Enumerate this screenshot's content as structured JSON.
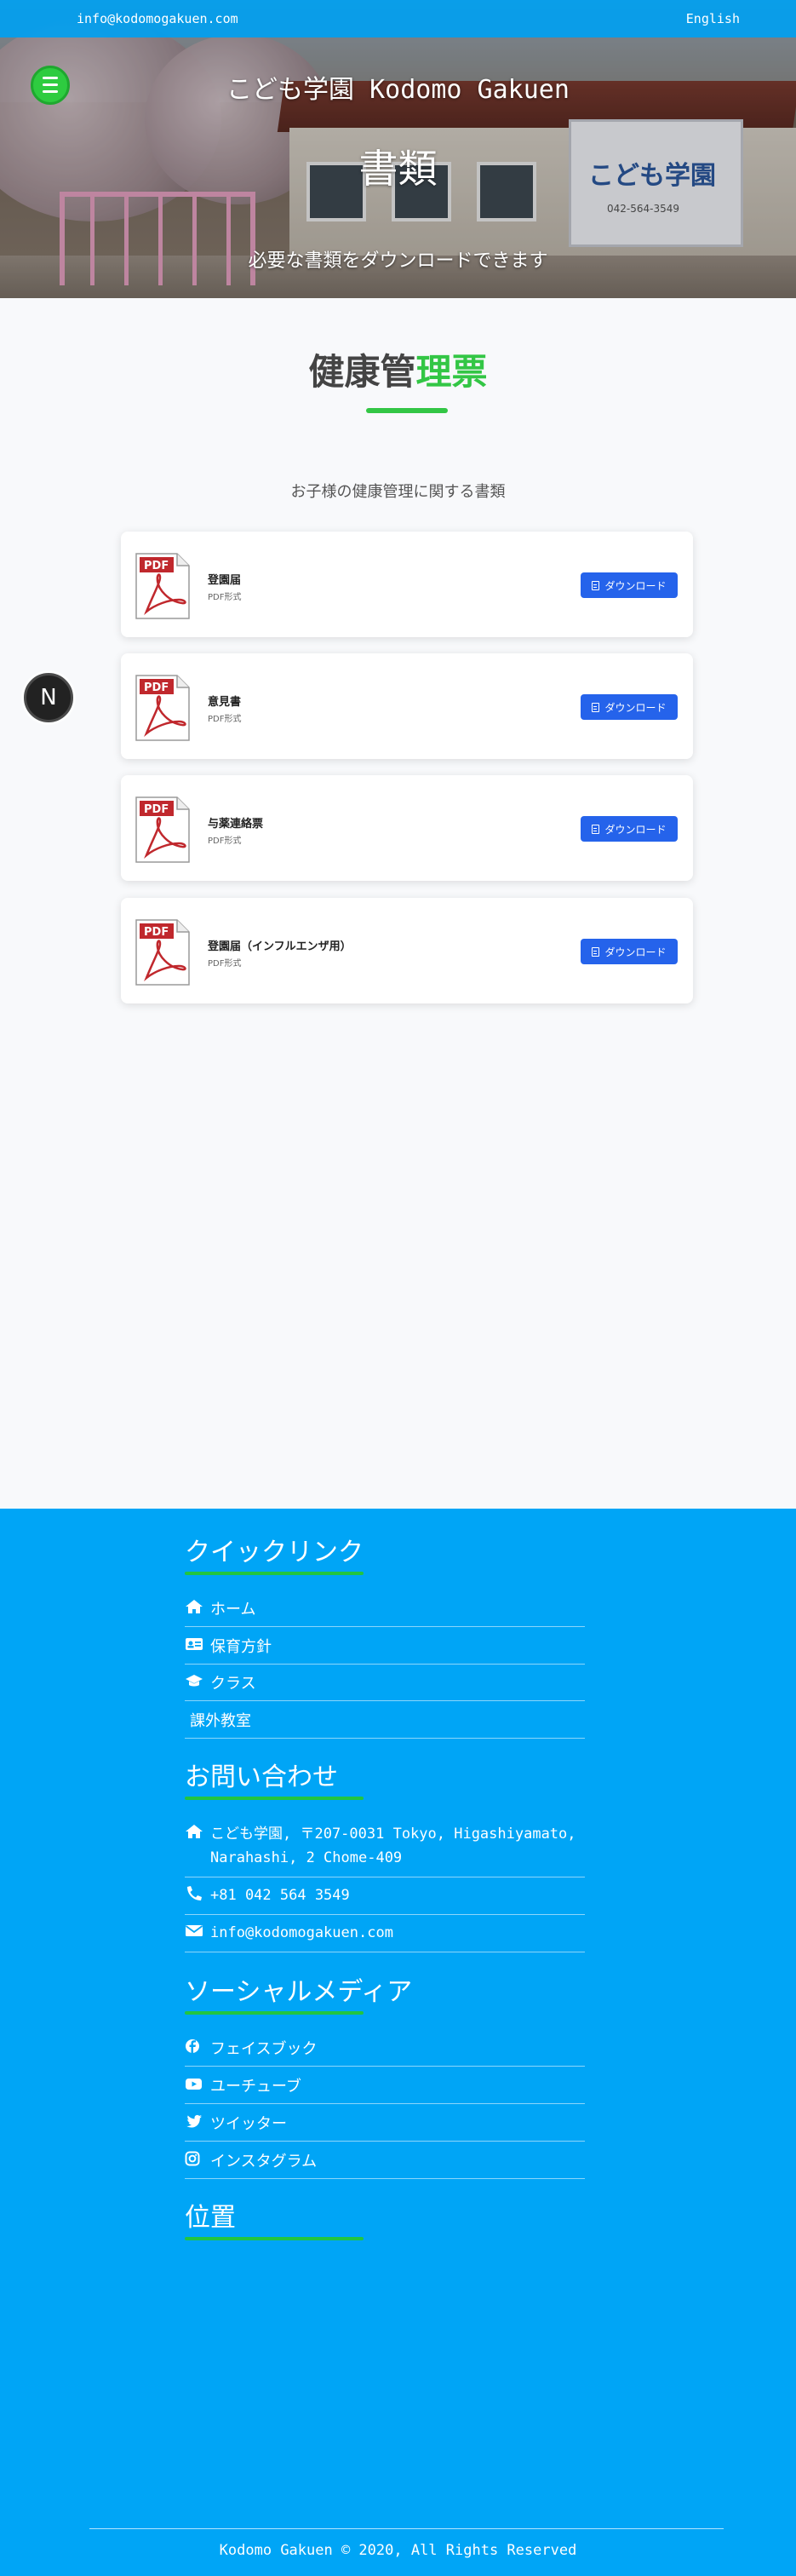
{
  "topbar": {
    "email": "info@kodomogakuen.com",
    "language": "English"
  },
  "hero": {
    "site_title": "こども学園 Kodomo Gakuen",
    "page_title": "書類",
    "subtitle": "必要な書類をダウンロードできます",
    "sign_text": "こども学園",
    "sign_phone": "042-564-3549"
  },
  "section": {
    "title_main": "健康管",
    "title_accent": "理票",
    "description": "お子様の健康管理に関する書類"
  },
  "documents": [
    {
      "name": "登園届",
      "type": "PDF形式",
      "button": "ダウンロード"
    },
    {
      "name": "意見書",
      "type": "PDF形式",
      "button": "ダウンロード"
    },
    {
      "name": "与薬連絡票",
      "type": "PDF形式",
      "button": "ダウンロード"
    },
    {
      "name": "登園届（インフルエンザ用）",
      "type": "PDF形式",
      "button": "ダウンロード"
    }
  ],
  "badge": {
    "letter": "N"
  },
  "footer": {
    "quick_links": {
      "heading": "クイックリンク",
      "items": [
        "ホーム",
        "保育方針",
        "クラス",
        "課外教室"
      ]
    },
    "contact": {
      "heading": "お問い合わせ",
      "address_line1": "こども学園, 〒207-0031 Tokyo, Higashiyamato,",
      "address_line2": "Narahashi, 2 Chome-409",
      "phone": "+81 042 564 3549",
      "email": "info@kodomogakuen.com"
    },
    "social": {
      "heading": "ソーシャルメディア",
      "items": [
        "フェイスブック",
        "ユーチューブ",
        "ツイッター",
        "インスタグラム"
      ]
    },
    "location": {
      "heading": "位置"
    },
    "copyright": "Kodomo Gakuen © 2020, All Rights Reserved"
  },
  "colors": {
    "accent_green": "#33c645",
    "footer_blue": "#00a5f6",
    "button_blue": "#2563eb",
    "pdf_red": "#c0282d"
  }
}
